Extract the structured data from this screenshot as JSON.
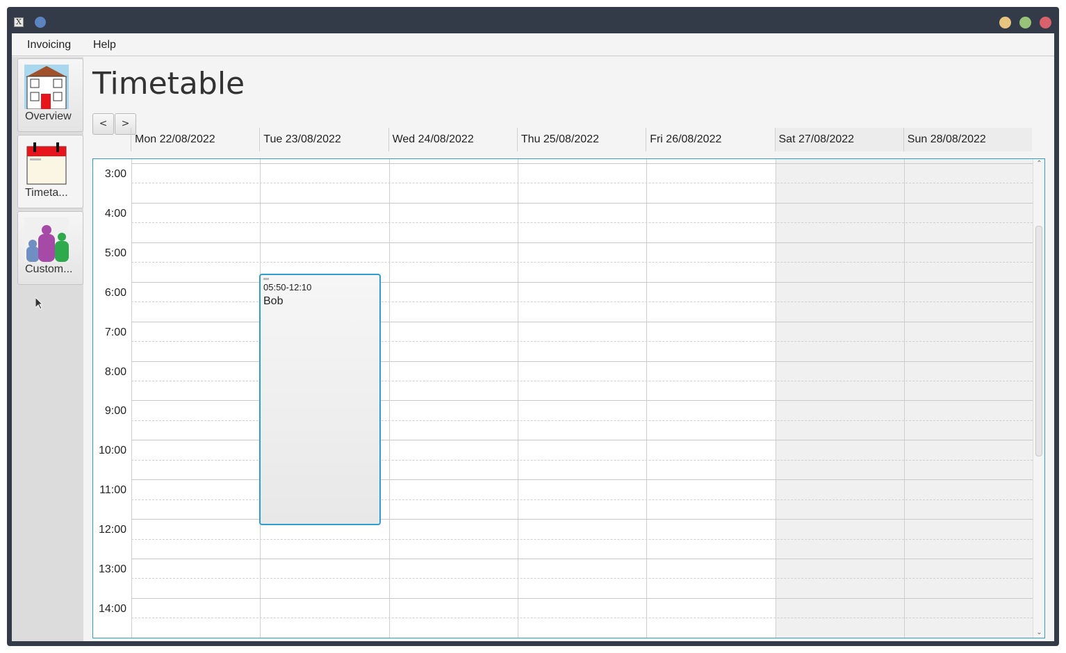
{
  "window": {
    "title_icon_glyph": "X"
  },
  "menubar": {
    "items": [
      "Invoicing",
      "Help"
    ]
  },
  "sidebar": {
    "items": [
      {
        "label": "Overview",
        "icon": "house-icon"
      },
      {
        "label": "Timeta...",
        "icon": "calendar-icon"
      },
      {
        "label": "Custom...",
        "icon": "customers-icon"
      }
    ]
  },
  "main": {
    "title": "Timetable",
    "prev_label": "<",
    "next_label": ">"
  },
  "days": [
    {
      "label": "Mon 22/08/2022",
      "weekend": false
    },
    {
      "label": "Tue 23/08/2022",
      "weekend": false
    },
    {
      "label": "Wed 24/08/2022",
      "weekend": false
    },
    {
      "label": "Thu 25/08/2022",
      "weekend": false
    },
    {
      "label": "Fri 26/08/2022",
      "weekend": false
    },
    {
      "label": "Sat 27/08/2022",
      "weekend": true
    },
    {
      "label": "Sun 28/08/2022",
      "weekend": true
    }
  ],
  "hours": [
    "3:00",
    "4:00",
    "5:00",
    "6:00",
    "7:00",
    "8:00",
    "9:00",
    "10:00",
    "11:00",
    "12:00",
    "13:00",
    "14:00"
  ],
  "appointment": {
    "time": "05:50-12:10",
    "name": "Bob",
    "day": "Tue 23/08/2022"
  },
  "colors": {
    "accent": "#2f9bd3",
    "titlebar": "#343b48"
  }
}
